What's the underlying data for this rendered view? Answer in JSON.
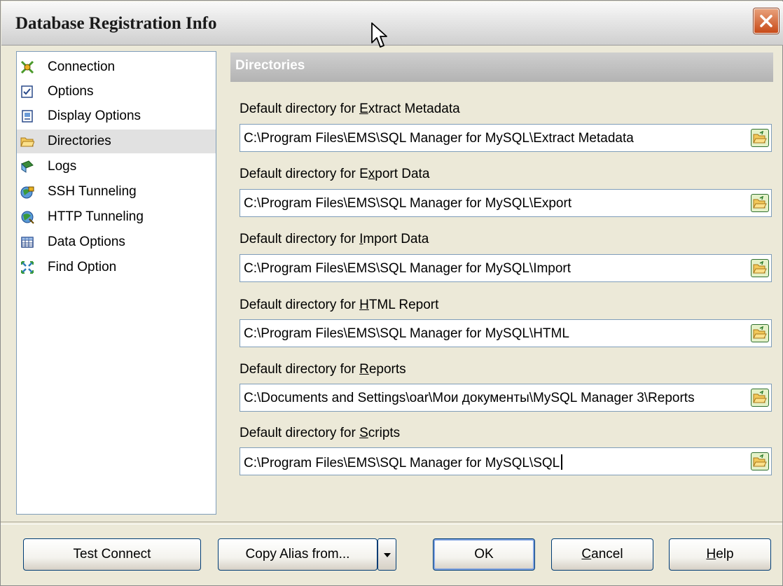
{
  "window": {
    "title": "Database Registration Info",
    "close_icon": "close-icon"
  },
  "sidebar": {
    "items": [
      {
        "label": "Connection",
        "icon": "connection-icon",
        "selected": false
      },
      {
        "label": "Options",
        "icon": "options-icon",
        "selected": false
      },
      {
        "label": "Display Options",
        "icon": "display-options-icon",
        "selected": false
      },
      {
        "label": "Directories",
        "icon": "folder-icon",
        "selected": true
      },
      {
        "label": "Logs",
        "icon": "logs-icon",
        "selected": false
      },
      {
        "label": "SSH Tunneling",
        "icon": "ssh-tunneling-icon",
        "selected": false
      },
      {
        "label": "HTTP Tunneling",
        "icon": "http-tunneling-icon",
        "selected": false
      },
      {
        "label": "Data Options",
        "icon": "data-options-icon",
        "selected": false
      },
      {
        "label": "Find Option",
        "icon": "find-option-icon",
        "selected": false
      }
    ]
  },
  "main": {
    "section_title": "Directories",
    "fields": [
      {
        "label_pre": "Default directory for ",
        "label_key": "E",
        "label_post": "xtract Metadata",
        "value": "C:\\Program Files\\EMS\\SQL Manager for MySQL\\Extract Metadata"
      },
      {
        "label_pre": "Default directory for E",
        "label_key": "x",
        "label_post": "port Data",
        "value": "C:\\Program Files\\EMS\\SQL Manager for MySQL\\Export"
      },
      {
        "label_pre": "Default directory for ",
        "label_key": "I",
        "label_post": "mport Data",
        "value": "C:\\Program Files\\EMS\\SQL Manager for MySQL\\Import"
      },
      {
        "label_pre": "Default directory for ",
        "label_key": "H",
        "label_post": "TML Report",
        "value": "C:\\Program Files\\EMS\\SQL Manager for MySQL\\HTML"
      },
      {
        "label_pre": "Default directory for ",
        "label_key": "R",
        "label_post": "eports",
        "value": "C:\\Documents and Settings\\oar\\Мои документы\\MySQL Manager 3\\Reports"
      },
      {
        "label_pre": "Default directory for ",
        "label_key": "S",
        "label_post": "cripts",
        "value": "C:\\Program Files\\EMS\\SQL Manager for MySQL\\SQL"
      }
    ]
  },
  "buttons": {
    "test_connect": "Test Connect",
    "copy_alias": "Copy Alias from...",
    "ok": "OK",
    "cancel_key": "C",
    "cancel_rest": "ancel",
    "help_key": "H",
    "help_rest": "elp"
  },
  "colors": {
    "section_header": "#b3b3b3",
    "selected_item": "#e1e1e1",
    "close_button": "#c84a18"
  }
}
